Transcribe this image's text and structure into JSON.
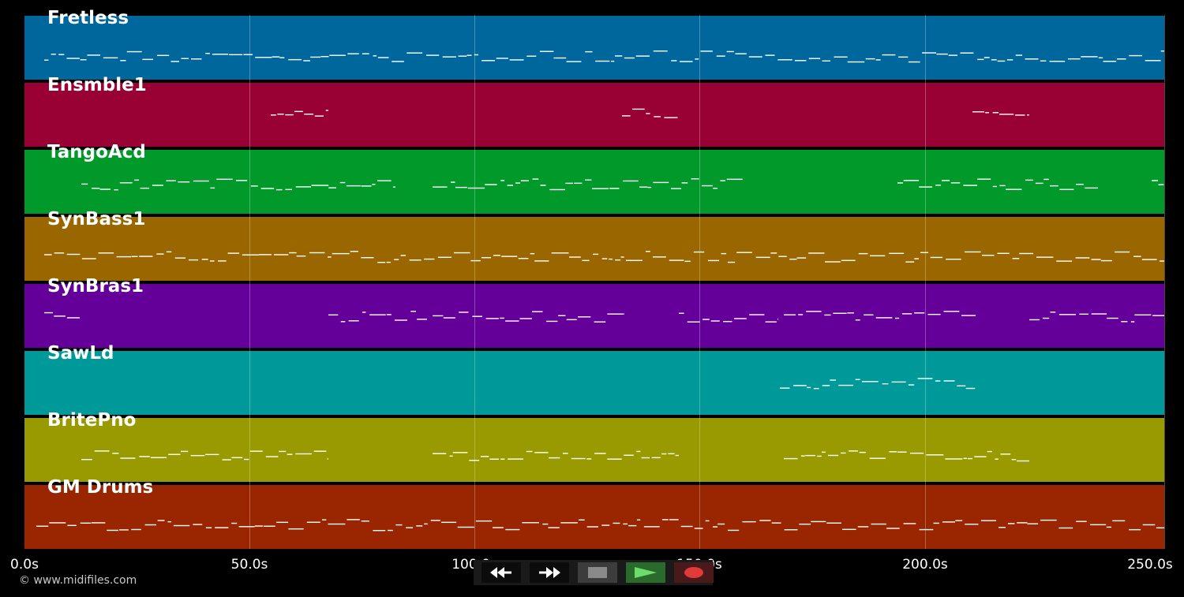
{
  "tracks": [
    {
      "name": "Fretless",
      "color": "#00679c"
    },
    {
      "name": "Ensmble1",
      "color": "#990033"
    },
    {
      "name": "TangoAcd",
      "color": "#00992a"
    },
    {
      "name": "SynBass1",
      "color": "#996600"
    },
    {
      "name": "SynBras1",
      "color": "#640099"
    },
    {
      "name": "SawLd",
      "color": "#00999a"
    },
    {
      "name": "BritePno",
      "color": "#999900"
    },
    {
      "name": "GM Drums",
      "color": "#992600"
    }
  ],
  "timeline": {
    "ticks": [
      "0.0s",
      "50.0s",
      "100.0s",
      "150.0s",
      "200.0s",
      "250.0s"
    ]
  },
  "transport": {
    "rewind_icon": "rewind-icon",
    "forward_icon": "fast-forward-icon",
    "stop_icon": "stop-icon",
    "play_icon": "play-icon",
    "record_icon": "record-icon"
  },
  "footer": {
    "copyright": "© www.midifiles.com"
  }
}
